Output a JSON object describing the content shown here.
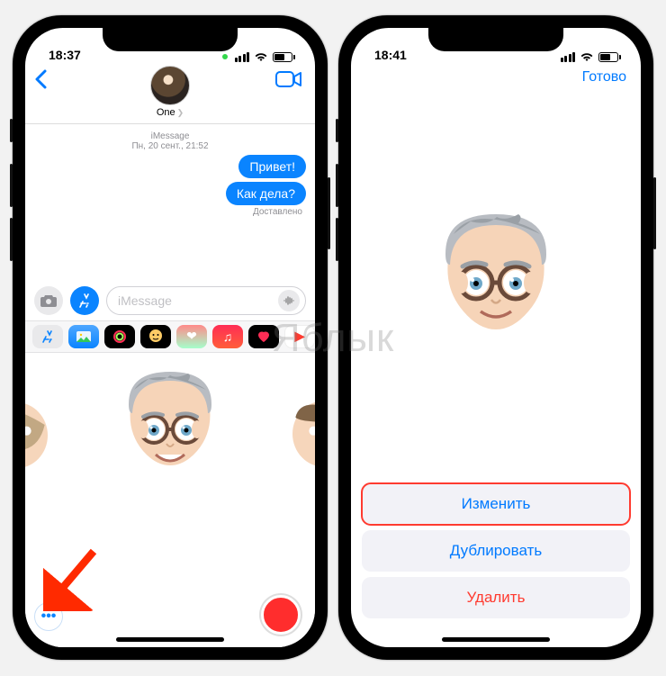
{
  "watermark": "Яблык",
  "left": {
    "status": {
      "time": "18:37"
    },
    "contact_name": "One",
    "meta_service": "iMessage",
    "meta_date": "Пн, 20 сент., 21:52",
    "messages": [
      "Привет!",
      "Как дела?"
    ],
    "delivered_label": "Доставлено",
    "input_placeholder": "iMessage",
    "more_label": "•••"
  },
  "right": {
    "status": {
      "time": "18:41"
    },
    "done_label": "Готово",
    "actions": {
      "edit": "Изменить",
      "duplicate": "Дублировать",
      "delete": "Удалить"
    }
  }
}
